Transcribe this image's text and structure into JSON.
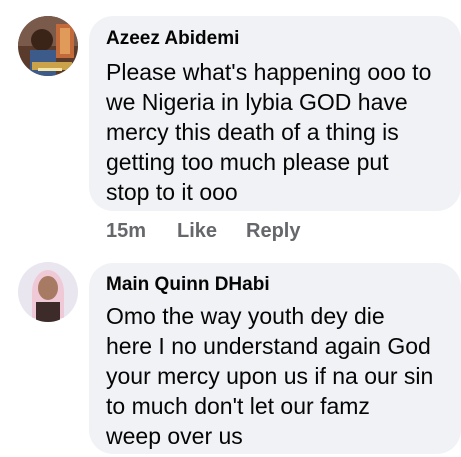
{
  "comments": [
    {
      "author": "Azeez Abidemi",
      "avatar_icon": "profile-photo-avatar",
      "text_lines": [
        "Please what's happening ooo to",
        "we Nigeria in lybia GOD have",
        "mercy this death of a thing is",
        "getting too much please put",
        "stop to it ooo"
      ],
      "actions": {
        "time": "15m",
        "like": "Like",
        "reply": "Reply"
      }
    },
    {
      "author": "Main Quinn DHabi",
      "avatar_icon": "profile-photo-avatar",
      "text_lines": [
        "Omo the way youth dey die",
        "here I no understand again God",
        "your mercy upon us if na our sin",
        "to much don't let our famz",
        "weep over us"
      ]
    }
  ],
  "colors": {
    "bubble_bg": "#f0f2f5",
    "text": "#050505",
    "secondary_text": "#65676b"
  }
}
